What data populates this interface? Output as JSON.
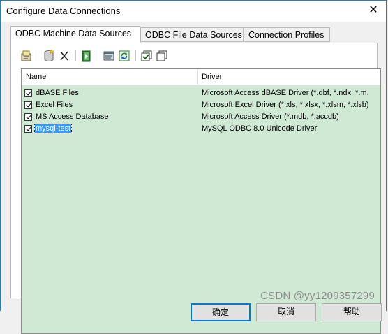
{
  "window": {
    "title": "Configure Data Connections",
    "close_glyph": "✕"
  },
  "tabs": [
    {
      "label": "ODBC Machine Data Sources"
    },
    {
      "label": "ODBC File Data Sources"
    },
    {
      "label": "Connection Profiles"
    }
  ],
  "toolbar": {
    "icons": [
      "configure-icon",
      "new-database-icon",
      "delete-icon",
      "test-connection-icon",
      "properties-icon",
      "refresh-icon",
      "select-all-icon",
      "copy-icon"
    ]
  },
  "list": {
    "columns": [
      "Name",
      "Driver"
    ],
    "rows": [
      {
        "name": "dBASE Files",
        "driver": "Microsoft Access dBASE Driver (*.dbf, *.ndx, *.m...",
        "checked": true
      },
      {
        "name": "Excel Files",
        "driver": "Microsoft Excel Driver (*.xls, *.xlsx, *.xlsm, *.xlsb)",
        "checked": true
      },
      {
        "name": "MS Access Database",
        "driver": "Microsoft Access Driver (*.mdb, *.accdb)",
        "checked": true
      },
      {
        "name": "mysql-test",
        "driver": "MySQL ODBC 8.0 Unicode Driver",
        "checked": true,
        "selected": true
      }
    ]
  },
  "buttons": {
    "ok": "确定",
    "cancel": "取消",
    "help": "帮助"
  },
  "watermark": "CSDN @yy1209357299"
}
